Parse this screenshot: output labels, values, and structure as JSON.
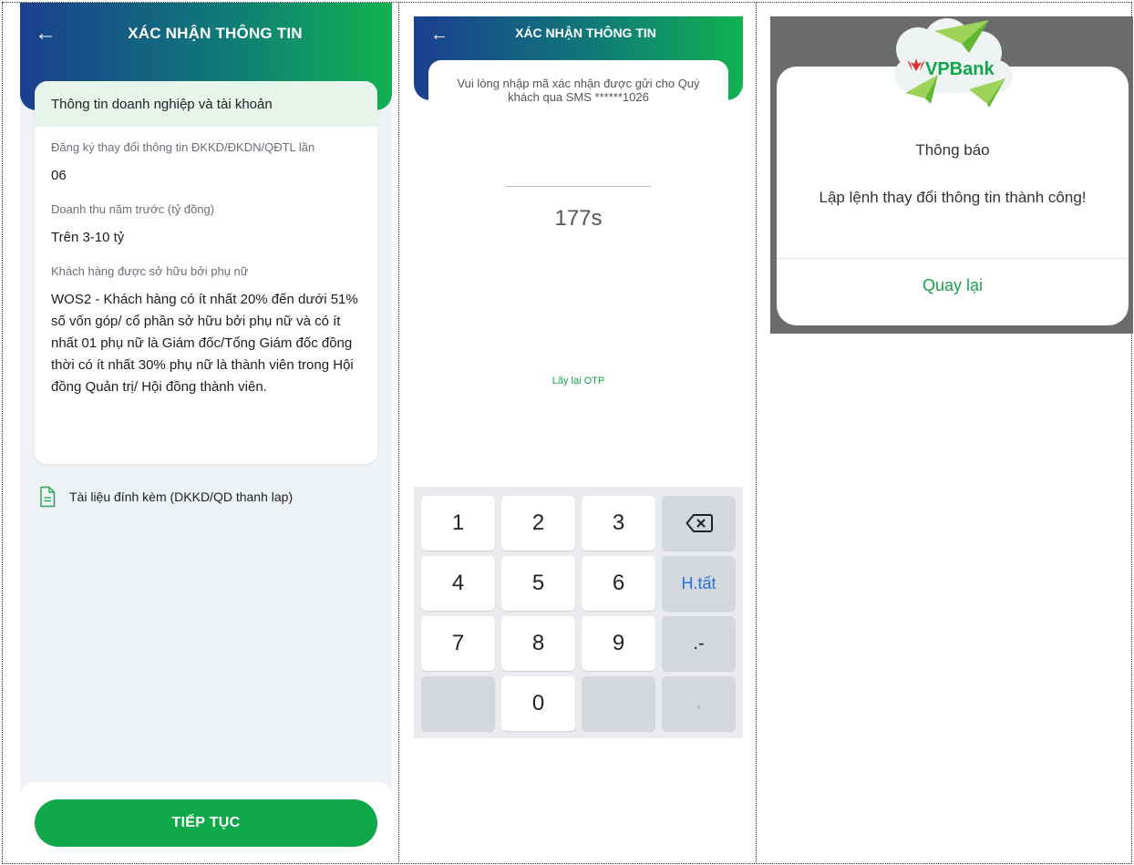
{
  "panel1": {
    "title": "XÁC NHẬN THÔNG TIN",
    "section_title": "Thông tin doanh nghiệp và tài khoản",
    "fields": [
      {
        "label": "Đăng ký thay đổi thông tin ĐKKD/ĐKDN/QĐTL lần",
        "value": "06"
      },
      {
        "label": "Doanh thu năm trước (tỷ đồng)",
        "value": "Trên 3-10 tỷ"
      },
      {
        "label": "Khách hàng được sở hữu bởi phụ nữ",
        "value": "WOS2 - Khách hàng có ít nhất 20% đến dưới 51% số vốn góp/ cổ phần sở hữu bởi phụ nữ và có ít nhất 01 phụ nữ là Giám đốc/Tổng Giám đốc đồng thời có ít nhất 30% phụ nữ là thành viên trong Hội đồng Quản trị/ Hội đồng thành viên."
      }
    ],
    "attachment": "Tài liệu đính kèm (DKKD/QD thanh lap)",
    "cta": "TIẾP TỤC"
  },
  "panel2": {
    "title": "XÁC NHẬN THÔNG TIN",
    "otp_message": "Vui lòng nhập mã xác nhận được gửi cho Quý khách qua SMS ******1026",
    "timer": "177s",
    "resend": "Lấy lại OTP",
    "keypad": {
      "row1": [
        "1",
        "2",
        "3"
      ],
      "row2": [
        "4",
        "5",
        "6"
      ],
      "done": "H.tất",
      "row3": [
        "7",
        "8",
        "9"
      ],
      "dot_dash": ".-",
      "zero": "0",
      "comma": ","
    }
  },
  "panel3": {
    "brand": "VPBank",
    "title": "Thông báo",
    "message": "Lập lệnh thay đổi thông tin thành công!",
    "button": "Quay lại"
  }
}
